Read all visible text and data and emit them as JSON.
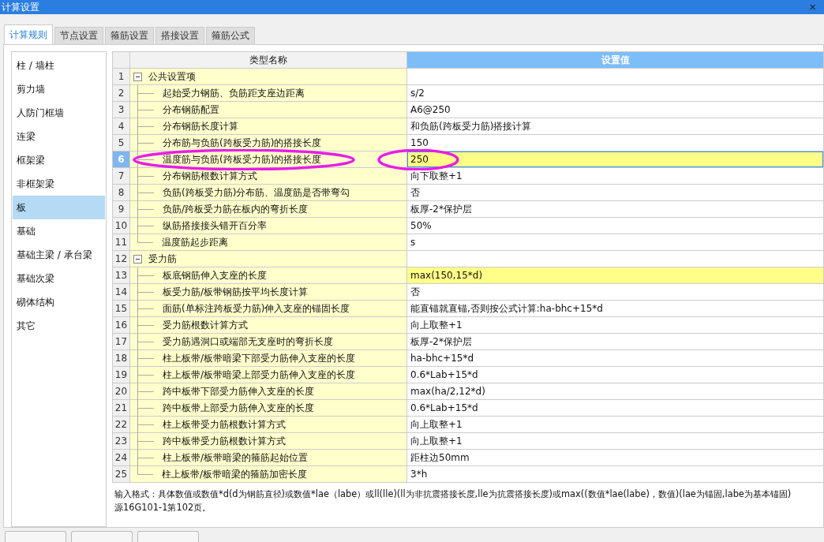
{
  "window": {
    "title": "计算设置",
    "close": "×"
  },
  "tabs": [
    {
      "label": "计算规则",
      "selected": true
    },
    {
      "label": "节点设置",
      "selected": false
    },
    {
      "label": "箍筋设置",
      "selected": false
    },
    {
      "label": "搭接设置",
      "selected": false
    },
    {
      "label": "箍筋公式",
      "selected": false
    }
  ],
  "sidebar": {
    "items": [
      {
        "label": "柱 / 墙柱",
        "selected": false
      },
      {
        "label": "剪力墙",
        "selected": false
      },
      {
        "label": "人防门框墙",
        "selected": false
      },
      {
        "label": "连梁",
        "selected": false
      },
      {
        "label": "框架梁",
        "selected": false
      },
      {
        "label": "非框架梁",
        "selected": false
      },
      {
        "label": "板",
        "selected": true
      },
      {
        "label": "基础",
        "selected": false
      },
      {
        "label": "基础主梁 / 承台梁",
        "selected": false
      },
      {
        "label": "基础次梁",
        "selected": false
      },
      {
        "label": "砌体结构",
        "selected": false
      },
      {
        "label": "其它",
        "selected": false
      }
    ]
  },
  "table": {
    "columns": [
      "类型名称",
      "设置值"
    ],
    "rows": [
      {
        "no": "1",
        "kind": "group",
        "name": "公共设置项",
        "expanded": true,
        "value": "",
        "selected": false,
        "modified": false
      },
      {
        "no": "2",
        "kind": "item",
        "name": "起始受力钢筋、负筋距支座边距离",
        "value": "s/2",
        "selected": false,
        "modified": false
      },
      {
        "no": "3",
        "kind": "item",
        "name": "分布钢筋配置",
        "value": "A6@250",
        "selected": false,
        "modified": false
      },
      {
        "no": "4",
        "kind": "item",
        "name": "分布钢筋长度计算",
        "value": "和负筋(跨板受力筋)搭接计算",
        "selected": false,
        "modified": false
      },
      {
        "no": "5",
        "kind": "item",
        "name": "分布筋与负筋(跨板受力筋)的搭接长度",
        "value": "150",
        "selected": false,
        "modified": false
      },
      {
        "no": "6",
        "kind": "item",
        "name": "温度筋与负筋(跨板受力筋)的搭接长度",
        "value": "250",
        "selected": true,
        "modified": true
      },
      {
        "no": "7",
        "kind": "item",
        "name": "分布钢筋根数计算方式",
        "value": "向下取整+1",
        "selected": false,
        "modified": false
      },
      {
        "no": "8",
        "kind": "item",
        "name": "负筋(跨板受力筋)分布筋、温度筋是否带弯勾",
        "value": "否",
        "selected": false,
        "modified": false
      },
      {
        "no": "9",
        "kind": "item",
        "name": "负筋/跨板受力筋在板内的弯折长度",
        "value": "板厚-2*保护层",
        "selected": false,
        "modified": false
      },
      {
        "no": "10",
        "kind": "item",
        "name": "纵筋搭接接头错开百分率",
        "value": "50%",
        "selected": false,
        "modified": false
      },
      {
        "no": "11",
        "kind": "item",
        "name": "温度筋起步距离",
        "value": "s",
        "selected": false,
        "modified": false
      },
      {
        "no": "12",
        "kind": "group",
        "name": "受力筋",
        "expanded": true,
        "value": "",
        "selected": false,
        "modified": false
      },
      {
        "no": "13",
        "kind": "item",
        "name": "板底钢筋伸入支座的长度",
        "value": "max(150,15*d)",
        "selected": false,
        "modified": true
      },
      {
        "no": "14",
        "kind": "item",
        "name": "板受力筋/板带钢筋按平均长度计算",
        "value": "否",
        "selected": false,
        "modified": false
      },
      {
        "no": "15",
        "kind": "item",
        "name": "面筋(单标注跨板受力筋)伸入支座的锚固长度",
        "value": "能直锚就直锚,否则按公式计算:ha-bhc+15*d",
        "selected": false,
        "modified": false
      },
      {
        "no": "16",
        "kind": "item",
        "name": "受力筋根数计算方式",
        "value": "向上取整+1",
        "selected": false,
        "modified": false
      },
      {
        "no": "17",
        "kind": "item",
        "name": "受力筋遇洞口或端部无支座时的弯折长度",
        "value": "板厚-2*保护层",
        "selected": false,
        "modified": false
      },
      {
        "no": "18",
        "kind": "item",
        "name": "柱上板带/板带暗梁下部受力筋伸入支座的长度",
        "value": "ha-bhc+15*d",
        "selected": false,
        "modified": false
      },
      {
        "no": "19",
        "kind": "item",
        "name": "柱上板带/板带暗梁上部受力筋伸入支座的长度",
        "value": "0.6*Lab+15*d",
        "selected": false,
        "modified": false
      },
      {
        "no": "20",
        "kind": "item",
        "name": "跨中板带下部受力筋伸入支座的长度",
        "value": "max(ha/2,12*d)",
        "selected": false,
        "modified": false
      },
      {
        "no": "21",
        "kind": "item",
        "name": "跨中板带上部受力筋伸入支座的长度",
        "value": "0.6*Lab+15*d",
        "selected": false,
        "modified": false
      },
      {
        "no": "22",
        "kind": "item",
        "name": "柱上板带受力筋根数计算方式",
        "value": "向上取整+1",
        "selected": false,
        "modified": false
      },
      {
        "no": "23",
        "kind": "item",
        "name": "跨中板带受力筋根数计算方式",
        "value": "向上取整+1",
        "selected": false,
        "modified": false
      },
      {
        "no": "24",
        "kind": "item",
        "name": "柱上板带/板带暗梁的箍筋起始位置",
        "value": "距柱边50mm",
        "selected": false,
        "modified": false
      },
      {
        "no": "25",
        "kind": "item",
        "name": "柱上板带/板带暗梁的箍筋加密长度",
        "value": "3*h",
        "selected": false,
        "modified": false
      }
    ]
  },
  "hint_lines": [
    "输入格式：具体数值或数值*d(d为钢筋直径)或数值*lae（labe）或ll(lle)(ll为非抗震搭接长度,lle为抗震搭接长度)或max((数值*lae(labe)，数值)(lae为锚固,labe为基本锚固)",
    "源16G101-1第102页。"
  ],
  "annotations": [
    {
      "kind": "ellipse"
    },
    {
      "kind": "ellipse"
    }
  ]
}
